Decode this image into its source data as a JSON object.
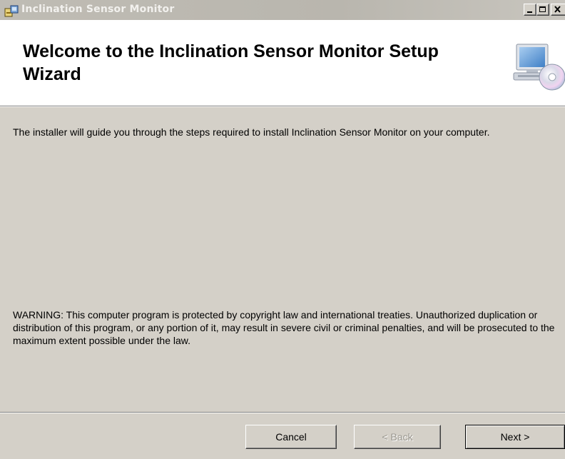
{
  "window": {
    "title": "Inclination Sensor Monitor",
    "icon": "installer-package-icon"
  },
  "banner": {
    "title": "Welcome to the Inclination Sensor Monitor Setup Wizard",
    "icon": "computer-with-cd-icon"
  },
  "content": {
    "intro": "The installer will guide you through the steps required to install Inclination Sensor Monitor on your computer.",
    "warning": "WARNING: This computer program is protected by copyright law and international treaties. Unauthorized duplication or distribution of this program, or any portion of it, may result in severe civil or criminal penalties, and will be prosecuted to the maximum extent possible under the law."
  },
  "buttons": {
    "cancel": "Cancel",
    "back": "< Back",
    "next": "Next >"
  },
  "colors": {
    "dialog_background": "#d4d0c8",
    "banner_background": "#ffffff",
    "disabled_text": "#9a978f"
  }
}
